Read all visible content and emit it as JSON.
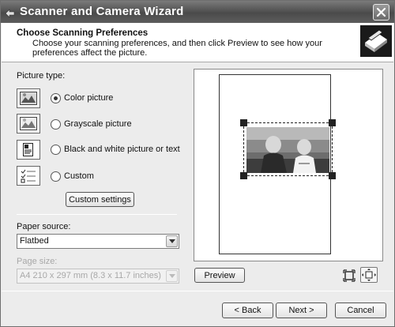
{
  "window": {
    "title": "Scanner and Camera Wizard",
    "icon": "wizard-icon",
    "close_icon": "close-icon"
  },
  "header": {
    "title": "Choose Scanning Preferences",
    "subtitle": "Choose your scanning preferences, and then click Preview to see how your preferences affect the picture.",
    "icon": "scanner-icon"
  },
  "picture_type": {
    "label": "Picture type:",
    "options": [
      {
        "label": "Color picture",
        "selected": true,
        "icon": "color-picture-icon"
      },
      {
        "label": "Grayscale picture",
        "selected": false,
        "icon": "grayscale-picture-icon"
      },
      {
        "label": "Black and white picture or text",
        "selected": false,
        "icon": "black-white-text-icon"
      },
      {
        "label": "Custom",
        "selected": false,
        "icon": "custom-icon"
      }
    ],
    "custom_settings_label": "Custom settings"
  },
  "paper_source": {
    "label": "Paper source:",
    "value": "Flatbed"
  },
  "page_size": {
    "label": "Page size:",
    "value": "A4 210 x 297 mm (8.3 x 11.7 inches)",
    "enabled": false
  },
  "preview": {
    "button_label": "Preview",
    "fit_icon": "fit-selection-icon",
    "zoom_icon": "zoom-icon"
  },
  "footer": {
    "back_label": "< Back",
    "next_label": "Next >",
    "cancel_label": "Cancel"
  }
}
